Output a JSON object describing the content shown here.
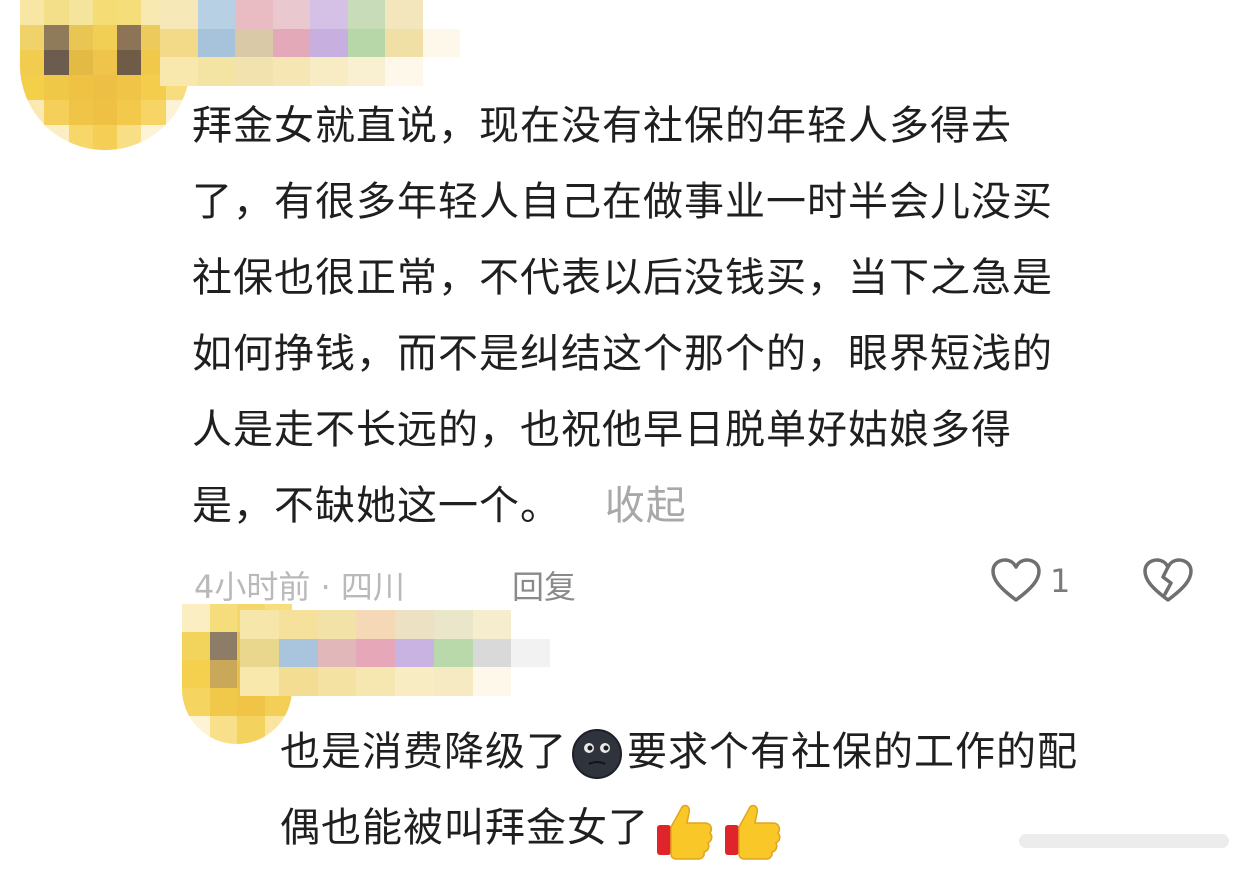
{
  "comment": {
    "lines": [
      "拜金女就直说，现在没有社保的年轻人多得去",
      "了，有很多年轻人自己在做事业一时半会儿没买",
      "社保也很正常，不代表以后没钱买，当下之急是",
      "如何挣钱，而不是纠结这个那个的，眼界短浅的",
      "人是走不长远的，也祝他早日脱单好姑娘多得",
      "是，不缺她这一个。"
    ],
    "collapse_label": "收起",
    "time_location": "4小时前 · 四川",
    "reply_label": "回复",
    "like_count": "1"
  },
  "reply": {
    "line1": "也是消费降级了",
    "line1_after": "要求个有社保的工作的配",
    "line2": "偶也能被叫拜金女了"
  },
  "icons": {
    "like": "heart-outline-icon",
    "dislike": "broken-heart-icon",
    "emoji_black": "black-moon-face-emoji",
    "emoji_thumb": "thumbs-up-emoji"
  },
  "colors": {
    "text": "#1f1f1f",
    "muted": "#b9b9b9",
    "avatar_yellow": "#f7d64a"
  }
}
